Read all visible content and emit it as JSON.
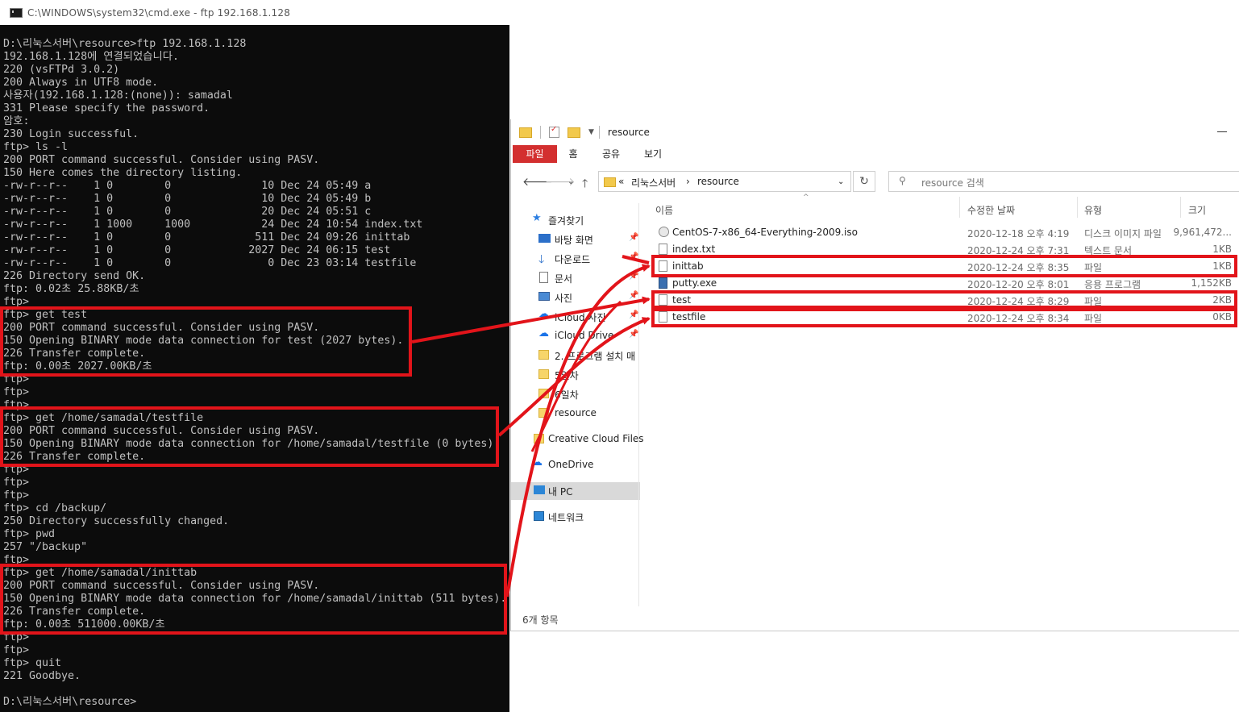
{
  "cmd": {
    "title": "C:\\WINDOWS\\system32\\cmd.exe - ftp  192.168.1.128",
    "lines": [
      "D:\\리눅스서버\\resource>ftp 192.168.1.128",
      "192.168.1.128에 연결되었습니다.",
      "220 (vsFTPd 3.0.2)",
      "200 Always in UTF8 mode.",
      "사용자(192.168.1.128:(none)): samadal",
      "331 Please specify the password.",
      "암호:",
      "230 Login successful.",
      "ftp> ls -l",
      "200 PORT command successful. Consider using PASV.",
      "150 Here comes the directory listing.",
      "-rw-r--r--    1 0        0              10 Dec 24 05:49 a",
      "-rw-r--r--    1 0        0              10 Dec 24 05:49 b",
      "-rw-r--r--    1 0        0              20 Dec 24 05:51 c",
      "-rw-r--r--    1 1000     1000           24 Dec 24 10:54 index.txt",
      "-rw-r--r--    1 0        0             511 Dec 24 09:26 inittab",
      "-rw-r--r--    1 0        0            2027 Dec 24 06:15 test",
      "-rw-r--r--    1 0        0               0 Dec 23 03:14 testfile",
      "226 Directory send OK.",
      "ftp: 0.02초 25.88KB/초",
      "ftp>",
      "ftp> get test",
      "200 PORT command successful. Consider using PASV.",
      "150 Opening BINARY mode data connection for test (2027 bytes).",
      "226 Transfer complete.",
      "ftp: 0.00초 2027.00KB/초",
      "ftp>",
      "ftp>",
      "ftp>",
      "ftp> get /home/samadal/testfile",
      "200 PORT command successful. Consider using PASV.",
      "150 Opening BINARY mode data connection for /home/samadal/testfile (0 bytes).",
      "226 Transfer complete.",
      "ftp>",
      "ftp>",
      "ftp>",
      "ftp> cd /backup/",
      "250 Directory successfully changed.",
      "ftp> pwd",
      "257 \"/backup\"",
      "ftp>",
      "ftp> get /home/samadal/inittab",
      "200 PORT command successful. Consider using PASV.",
      "150 Opening BINARY mode data connection for /home/samadal/inittab (511 bytes).",
      "226 Transfer complete.",
      "ftp: 0.00초 511000.00KB/초",
      "ftp>",
      "ftp>",
      "ftp> quit",
      "221 Goodbye.",
      "",
      "D:\\리눅스서버\\resource>"
    ]
  },
  "explorer": {
    "title": "resource",
    "tabs": [
      "파일",
      "홈",
      "공유",
      "보기"
    ],
    "breadcrumb": {
      "prefix": "«",
      "parent": "리눅스서버",
      "sep": "›",
      "current": "resource"
    },
    "search_placeholder": "resource 검색",
    "nav": [
      {
        "label": "즐겨찾기",
        "icon": "star-icon"
      },
      {
        "label": "바탕 화면",
        "icon": "desktop-icon"
      },
      {
        "label": "다운로드",
        "icon": "download-icon"
      },
      {
        "label": "문서",
        "icon": "document-icon"
      },
      {
        "label": "사진",
        "icon": "pictures-icon"
      },
      {
        "label": "iCloud 사진",
        "icon": "cloud-icon"
      },
      {
        "label": "iCloud Drive",
        "icon": "cloud-icon"
      },
      {
        "label": "2. 프로그램 설치 매",
        "icon": "folder-icon"
      },
      {
        "label": "5일차",
        "icon": "folder-icon"
      },
      {
        "label": "6일차",
        "icon": "folder-icon"
      },
      {
        "label": "resource",
        "icon": "folder-icon"
      },
      {
        "label": "Creative Cloud Files",
        "icon": "folder-icon"
      },
      {
        "label": "OneDrive",
        "icon": "cloud-icon"
      },
      {
        "label": "내 PC",
        "icon": "pc-icon"
      },
      {
        "label": "네트워크",
        "icon": "network-icon"
      }
    ],
    "columns": {
      "name": "이름",
      "date": "수정한 날짜",
      "type": "유형",
      "size": "크기"
    },
    "files": [
      {
        "name": "CentOS-7-x86_64-Everything-2009.iso",
        "date": "2020-12-18 오후 4:19",
        "type": "디스크 이미지 파일",
        "size": "9,961,472...",
        "icon": "disc-image-icon"
      },
      {
        "name": "index.txt",
        "date": "2020-12-24 오후 7:31",
        "type": "텍스트 문서",
        "size": "1KB",
        "icon": "text-file-icon"
      },
      {
        "name": "inittab",
        "date": "2020-12-24 오후 8:35",
        "type": "파일",
        "size": "1KB",
        "icon": "file-icon"
      },
      {
        "name": "putty.exe",
        "date": "2020-12-20 오후 8:01",
        "type": "응용 프로그램",
        "size": "1,152KB",
        "icon": "app-icon"
      },
      {
        "name": "test",
        "date": "2020-12-24 오후 8:29",
        "type": "파일",
        "size": "2KB",
        "icon": "file-icon"
      },
      {
        "name": "testfile",
        "date": "2020-12-24 오후 8:34",
        "type": "파일",
        "size": "0KB",
        "icon": "file-icon"
      }
    ],
    "status": "6개 항목"
  },
  "colors": {
    "highlight": "#e2141a",
    "cmd_bg": "#0c0c0c",
    "cmd_text": "#c0c0c0",
    "ribbon_file_tab": "#d32f2f"
  }
}
